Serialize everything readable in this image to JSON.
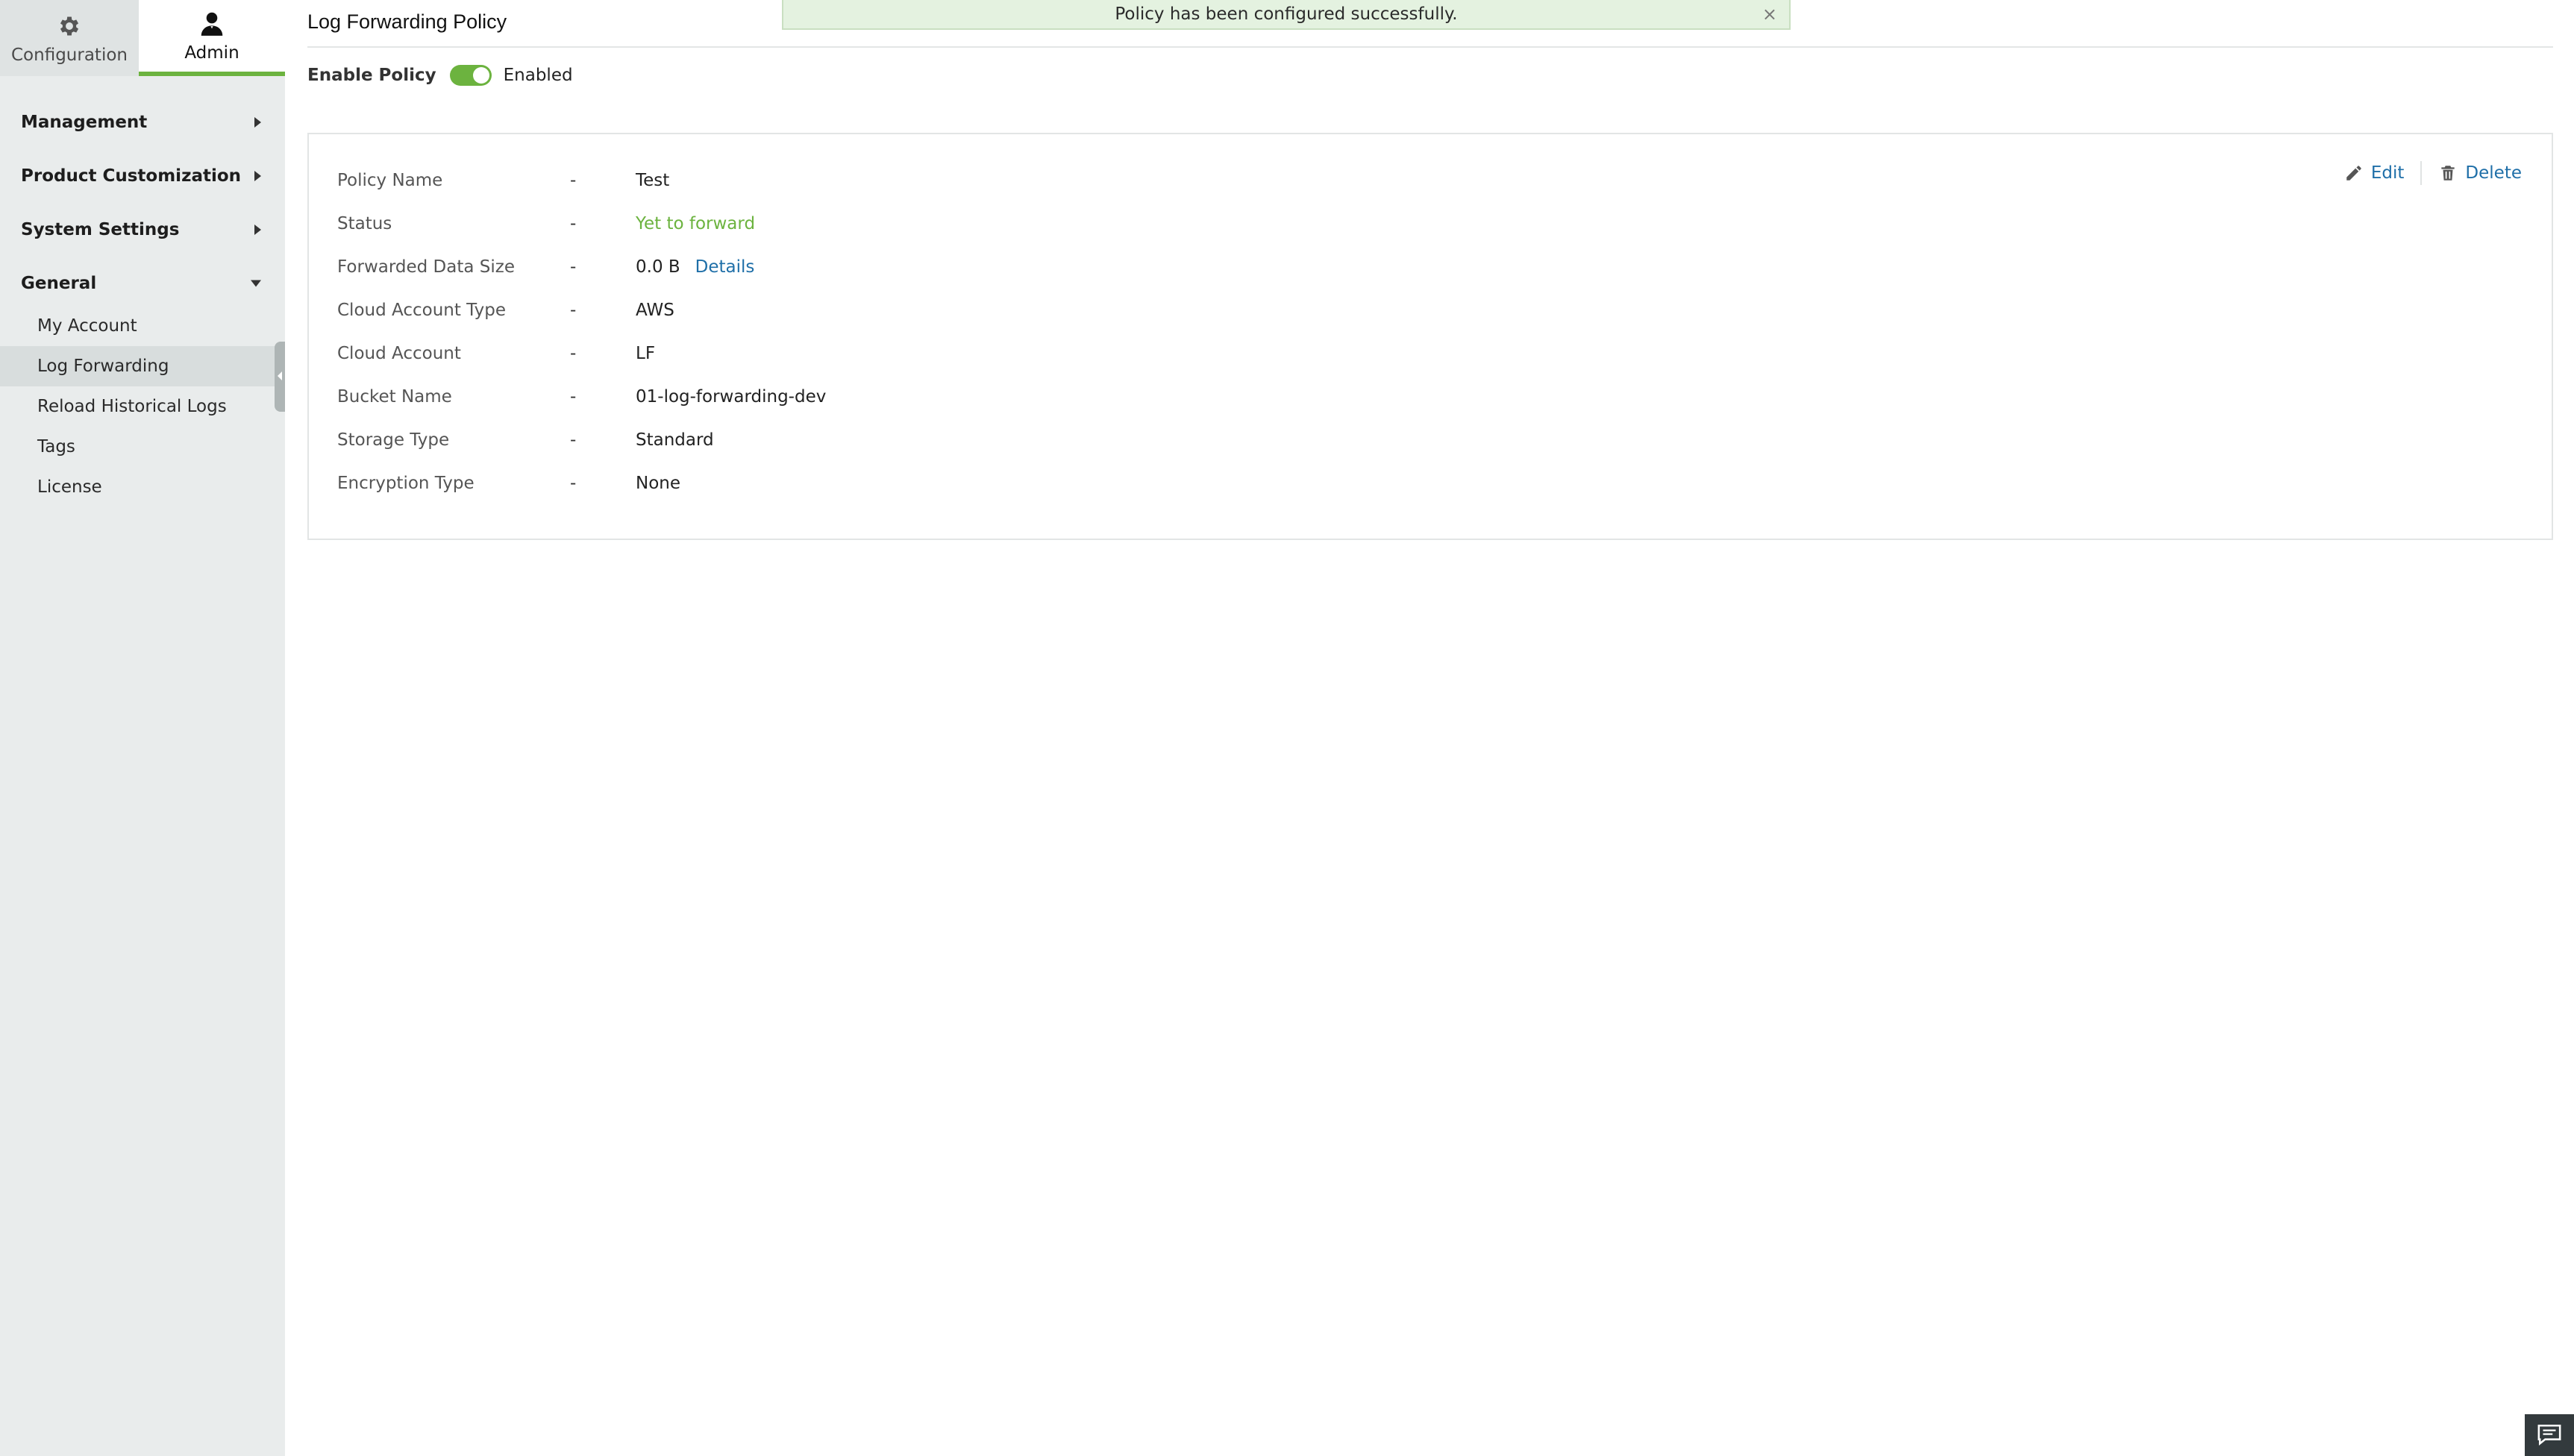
{
  "top_tabs": {
    "configuration_label": "Configuration",
    "admin_label": "Admin"
  },
  "sidebar": {
    "sections": [
      {
        "label": "Management",
        "expanded": false
      },
      {
        "label": "Product Customization",
        "expanded": false
      },
      {
        "label": "System Settings",
        "expanded": false
      },
      {
        "label": "General",
        "expanded": true
      }
    ],
    "general_items": [
      {
        "label": "My Account"
      },
      {
        "label": "Log Forwarding",
        "active": true
      },
      {
        "label": "Reload Historical Logs"
      },
      {
        "label": "Tags"
      },
      {
        "label": "License"
      }
    ]
  },
  "page": {
    "title": "Log Forwarding Policy",
    "toast": "Policy has been configured successfully.",
    "toast_close": "×",
    "enable_label": "Enable Policy",
    "enable_state": "Enabled"
  },
  "details": {
    "separator": "-",
    "rows": [
      {
        "label": "Policy Name",
        "value": "Test"
      },
      {
        "label": "Status",
        "value": "Yet to forward"
      },
      {
        "label": "Forwarded Data Size",
        "value": "0.0 B",
        "link": "Details"
      },
      {
        "label": "Cloud Account Type",
        "value": "AWS"
      },
      {
        "label": "Cloud Account",
        "value": "LF"
      },
      {
        "label": "Bucket Name",
        "value": "01-log-forwarding-dev"
      },
      {
        "label": "Storage Type",
        "value": "Standard"
      },
      {
        "label": "Encryption Type",
        "value": "None"
      }
    ]
  },
  "actions": {
    "edit_label": "Edit",
    "delete_label": "Delete"
  },
  "colors": {
    "accent_green": "#6cb33f",
    "link_blue": "#1f6fa8",
    "sidebar_bg": "#e9ecec",
    "toast_bg": "#e4f2e0"
  },
  "icons": {
    "configuration": "gear-icon",
    "admin": "user-icon",
    "edit": "pencil-icon",
    "delete": "trash-icon",
    "chat": "chat-icon",
    "toast_close": "close-icon"
  }
}
